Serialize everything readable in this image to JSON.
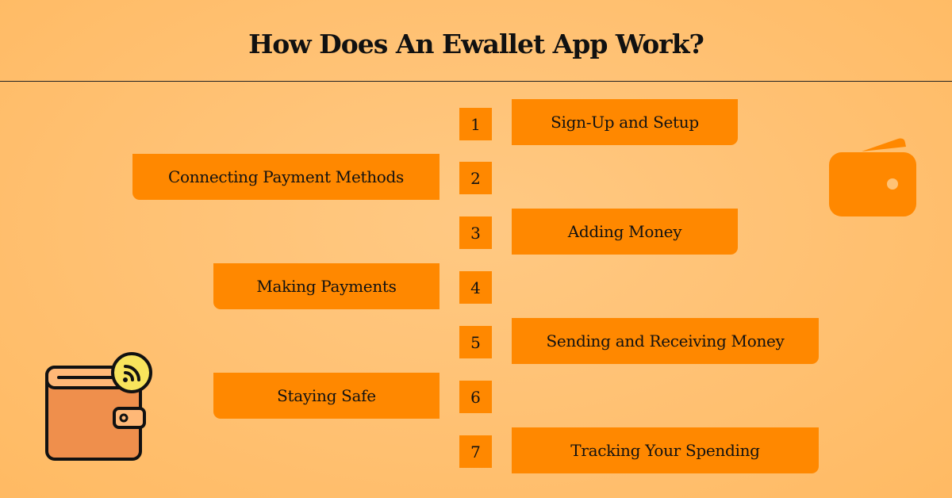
{
  "title": "How Does An Ewallet App Work?",
  "colors": {
    "accent": "#ff8800",
    "background": "#ffc275",
    "text": "#111111"
  },
  "steps": [
    {
      "number": "1",
      "label": "Sign-Up and Setup",
      "side": "right"
    },
    {
      "number": "2",
      "label": "Connecting Payment Methods",
      "side": "left"
    },
    {
      "number": "3",
      "label": "Adding Money",
      "side": "right"
    },
    {
      "number": "4",
      "label": "Making Payments",
      "side": "left"
    },
    {
      "number": "5",
      "label": "Sending and Receiving Money",
      "side": "right"
    },
    {
      "number": "6",
      "label": "Staying Safe",
      "side": "left"
    },
    {
      "number": "7",
      "label": "Tracking Your Spending",
      "side": "right"
    }
  ],
  "icons": {
    "top_right": "wallet-icon",
    "bottom_left": "contactless-wallet-icon"
  }
}
